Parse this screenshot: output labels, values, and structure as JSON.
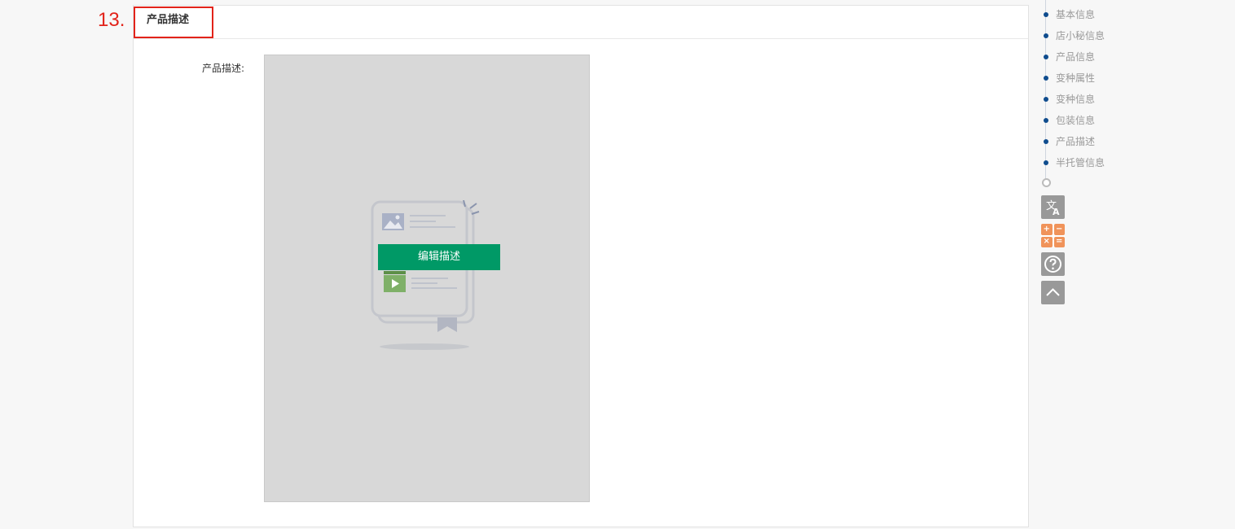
{
  "step_label": "13.",
  "section": {
    "title": "产品描述",
    "field_label": "产品描述:",
    "edit_button": "编辑描述"
  },
  "nav": {
    "items": [
      "基本信息",
      "店小秘信息",
      "产品信息",
      "变种属性",
      "变种信息",
      "包装信息",
      "产品描述",
      "半托管信息"
    ]
  },
  "tools": {
    "translate_icon": "translate-icon",
    "calculator_icon": "calculator-icon",
    "calc_symbols": [
      "+",
      "−",
      "×",
      "="
    ],
    "help_icon": "question-circle-icon",
    "back_to_top_icon": "chevron-up-icon"
  },
  "colors": {
    "highlight": "#e2231a",
    "button": "#009966",
    "nav_dot": "#0f4c8e",
    "calculator": "#f0935a"
  }
}
